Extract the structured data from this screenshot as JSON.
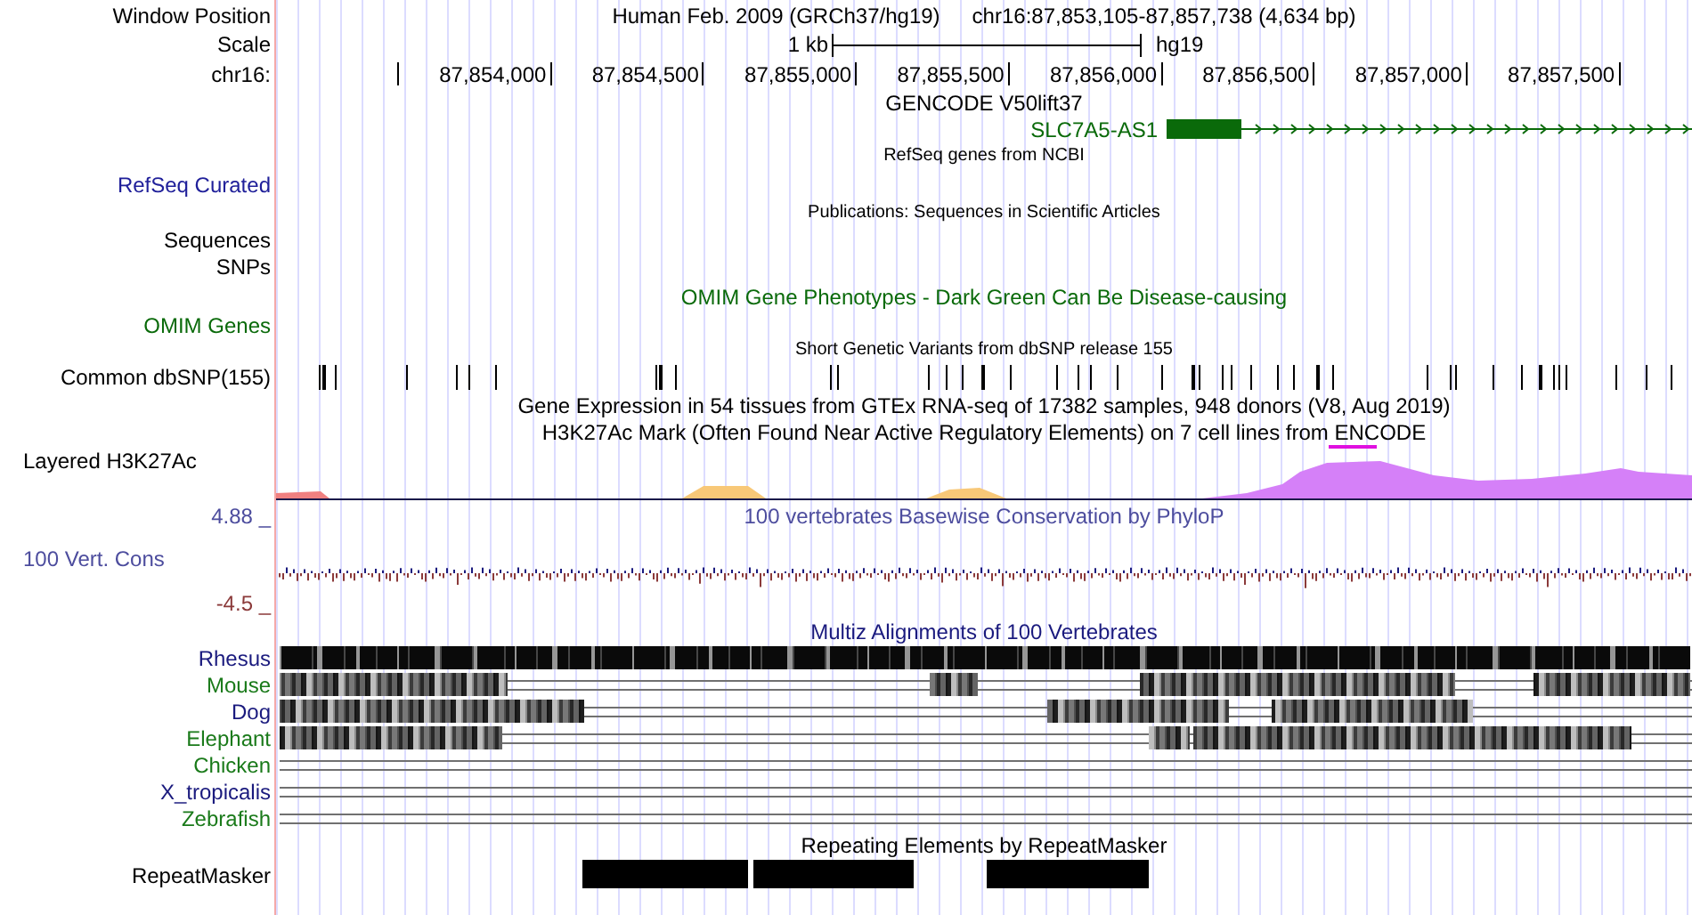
{
  "header": {
    "position_label": "Window Position",
    "title": "Human Feb. 2009 (GRCh37/hg19)",
    "position": "chr16:87,853,105-87,857,738 (4,634 bp)",
    "scale_label": "Scale",
    "scale_text": "1 kb",
    "assembly": "hg19",
    "chrom_label": "chr16:"
  },
  "ruler": {
    "ticks": [
      "87,854,000",
      "87,854,500",
      "87,855,000",
      "87,855,500",
      "87,856,000",
      "87,856,500",
      "87,857,000",
      "87,857,500"
    ]
  },
  "gencode": {
    "title": "GENCODE V50lift37",
    "gene": "SLC7A5-AS1"
  },
  "refseq": {
    "title": "RefSeq genes from NCBI",
    "label": "RefSeq Curated"
  },
  "publications": {
    "title": "Publications: Sequences in Scientific Articles",
    "labels": [
      "Sequences",
      "SNPs"
    ]
  },
  "omim": {
    "title": "OMIM Gene Phenotypes - Dark Green Can Be Disease-causing",
    "label": "OMIM Genes"
  },
  "dbsnp": {
    "title": "Short Genetic Variants from dbSNP release 155",
    "label": "Common dbSNP(155)"
  },
  "gtex": {
    "title": "Gene Expression in 54 tissues from GTEx RNA-seq of 17382 samples, 948 donors (V8, Aug 2019)"
  },
  "h3k27ac": {
    "title": "H3K27Ac Mark (Often Found Near Active Regulatory Elements) on 7 cell lines from ENCODE",
    "label": "Layered H3K27Ac"
  },
  "phylop": {
    "title": "100 vertebrates Basewise Conservation by PhyloP",
    "label": "100 Vert. Cons",
    "max": "4.88 _",
    "min": "-4.5 _"
  },
  "multiz": {
    "title": "Multiz Alignments of 100 Vertebrates",
    "species": [
      {
        "name": "Rhesus",
        "color": "#1a1a7e"
      },
      {
        "name": "Mouse",
        "color": "#1a7a1a"
      },
      {
        "name": "Dog",
        "color": "#1a1a7e"
      },
      {
        "name": "Elephant",
        "color": "#1a7a1a"
      },
      {
        "name": "Chicken",
        "color": "#1a7a1a"
      },
      {
        "name": "X_tropicalis",
        "color": "#1a1a7e"
      },
      {
        "name": "Zebrafish",
        "color": "#1a7a1a"
      }
    ]
  },
  "repeatmasker": {
    "title": "Repeating Elements by RepeatMasker",
    "label": "RepeatMasker"
  }
}
